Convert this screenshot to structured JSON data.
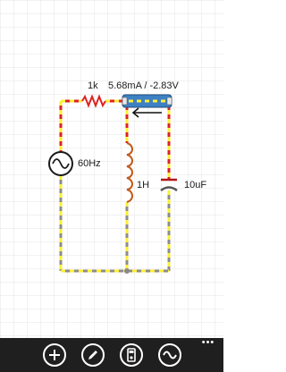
{
  "circuit": {
    "resistor_label": "1k",
    "meter_reading": "5.68mA / -2.83V",
    "source_label": "60Hz",
    "inductor_label": "1H",
    "capacitor_label": "10uF"
  },
  "appbar": {
    "add_icon": "plus-circle-icon",
    "edit_icon": "pencil-circle-icon",
    "meter_icon": "multimeter-circle-icon",
    "source_icon": "sine-wave-circle-icon",
    "more_label": "•••"
  },
  "colors": {
    "grid": "#e6e6e6",
    "wire_active": "#ffee33",
    "wire_positive": "#dd2222",
    "wire_neutral": "#8c8c8c",
    "meter_fill": "#3d80c4",
    "appbar_bg": "#1f1f1f"
  }
}
